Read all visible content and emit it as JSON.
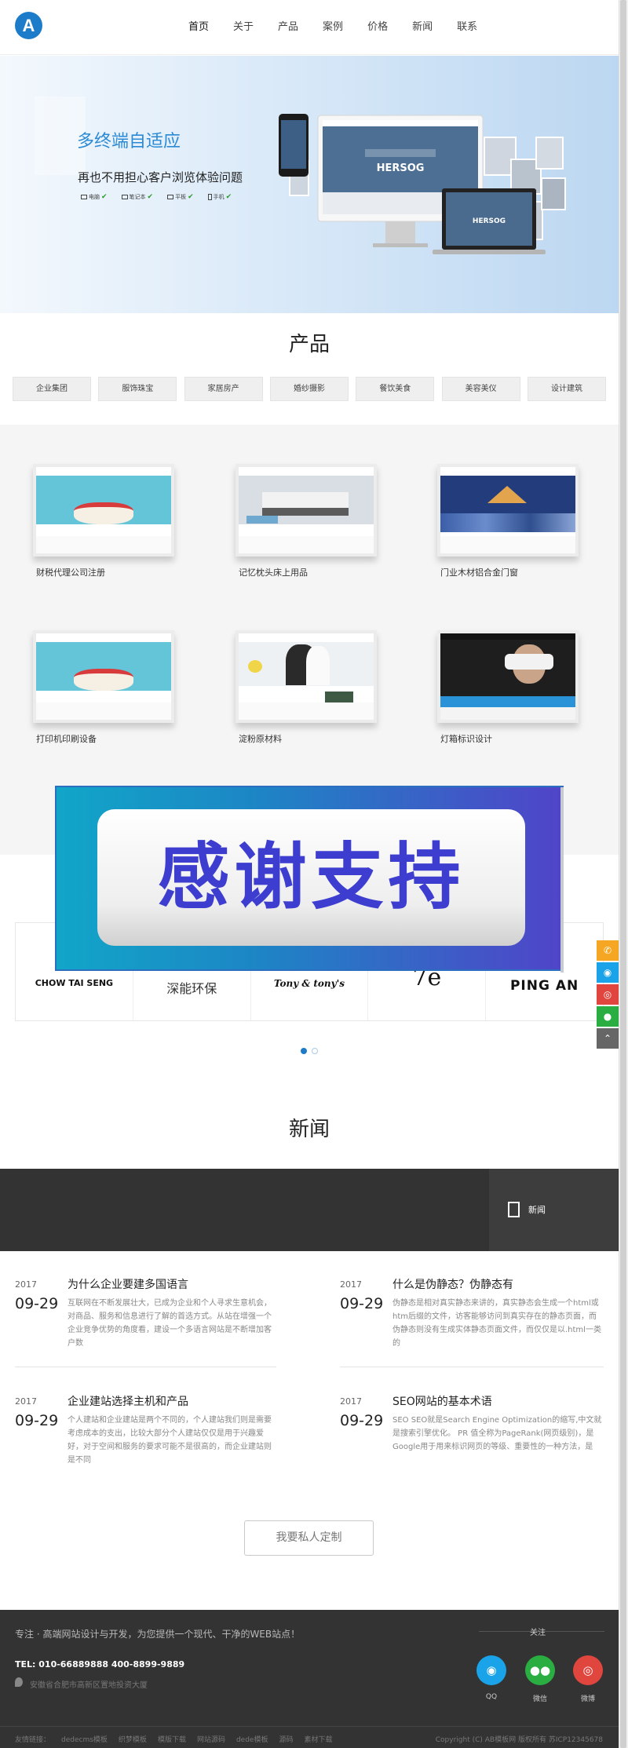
{
  "header": {
    "logo_letter": "A",
    "nav": [
      "首页",
      "关于",
      "产品",
      "案例",
      "价格",
      "新闻",
      "联系"
    ]
  },
  "banner": {
    "title": "多终端自适应",
    "subtitle": "再也不用担心客户浏览体验问题",
    "devices": [
      "电脑",
      "笔记本",
      "平板",
      "手机"
    ],
    "mockup_brand": "HERSOG"
  },
  "product": {
    "title": "产品",
    "tabs": [
      "企业集团",
      "服饰珠宝",
      "家居房产",
      "婚纱摄影",
      "餐饮美食",
      "美容美仪",
      "设计建筑"
    ],
    "cards": [
      {
        "caption": "财税代理公司注册"
      },
      {
        "caption": "记忆枕头床上用品"
      },
      {
        "caption": "门业木材铝合金门窗"
      },
      {
        "caption": "打印机印刷设备"
      },
      {
        "caption": "淀粉原材料"
      },
      {
        "caption": "灯箱标识设计"
      }
    ]
  },
  "overlay": {
    "text": "感谢支持"
  },
  "partners": [
    "CHOW TAI SENG",
    "深能环保",
    "Tony & tony's",
    "7e",
    "PING AN"
  ],
  "news": {
    "title": "新闻",
    "tab_label": "新闻",
    "items": [
      {
        "year": "2017",
        "day": "09-29",
        "headline": "为什么企业要建多国语言",
        "summary": "互联网在不断发展壮大，已成为企业和个人寻求生意机会，对商品、服务和信息进行了解的首选方式。从站在增强一个企业竞争优势的角度看，建设一个多语言网站是不断增加客户数"
      },
      {
        "year": "2017",
        "day": "09-29",
        "headline": "什么是伪静态？伪静态有",
        "summary": "伪静态是相对真实静态来讲的，真实静态会生成一个html或htm后缀的文件，访客能够访问到真实存在的静态页面，而伪静态则没有生成实体静态页面文件，而仅仅是以.html一类的"
      },
      {
        "year": "2017",
        "day": "09-29",
        "headline": "企业建站选择主机和产品",
        "summary": "个人建站和企业建站是两个不同的，个人建站我们则是需要考虑成本的支出，比较大部分个人建站仅仅是用于兴趣爱好，对于空间和服务的要求可能不是很高的，而企业建站则是不同"
      },
      {
        "year": "2017",
        "day": "09-29",
        "headline": "SEO网站的基本术语",
        "summary": "SEO SEO就是Search Engine Optimization的缩写,中文就是搜索引擎优化。 PR 值全称为PageRank(网页级别)，是Google用于用来标识网页的等级、重要性的一种方法，是"
      }
    ],
    "cta": "我要私人定制"
  },
  "footer": {
    "slogan": "专注 · 高端网站设计与开发，为您提供一个现代、干净的WEB站点！",
    "tel": "TEL: 010-66889888 400-8899-9889",
    "address": "安徽省合肥市高新区置地投资大厦",
    "follow_label": "关注",
    "social": [
      {
        "label": "QQ",
        "color": "#1aa3e8"
      },
      {
        "label": "微信",
        "color": "#2aae41"
      },
      {
        "label": "微博",
        "color": "#e1463e"
      }
    ],
    "links": [
      "友情链接：",
      "dedecms模板",
      "织梦模板",
      "模版下载",
      "网站源码",
      "dede模板",
      "源码",
      "素材下载"
    ],
    "copyright": "Copyright (C) AB模板网 版权所有 苏ICP12345678"
  },
  "side_tools": [
    {
      "icon": "phone-icon",
      "color": "#f5a623"
    },
    {
      "icon": "qq-icon",
      "color": "#1aa3e8"
    },
    {
      "icon": "weibo-icon",
      "color": "#e1463e"
    },
    {
      "icon": "wechat-icon",
      "color": "#2aae41"
    },
    {
      "icon": "back-to-top-icon",
      "color": "#666666"
    }
  ],
  "colors": {
    "accent": "#1d7cc9",
    "dark_band": "#333333",
    "footer_bg": "#333333"
  }
}
